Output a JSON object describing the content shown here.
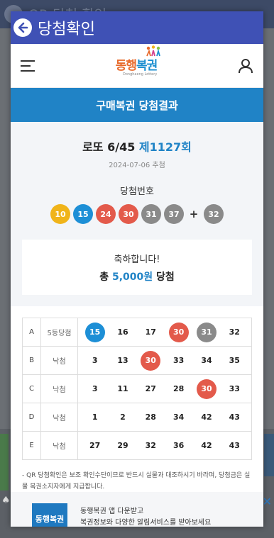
{
  "background": {
    "title": "QR 당첨 확인"
  },
  "dialog": {
    "title": "당첨확인"
  },
  "brand": {
    "name_a": "동행",
    "name_b": "복권",
    "sub": "Donghaeng Lottery"
  },
  "banner": {
    "title": "구매복권 당첨결과"
  },
  "result": {
    "game": "로또 6/45",
    "round": "제1127회",
    "date": "2024-07-06 추첨",
    "win_label": "당첨번호",
    "winning_numbers": [
      {
        "n": "10",
        "color": "#f0b41a"
      },
      {
        "n": "15",
        "color": "#1d8fd6"
      },
      {
        "n": "24",
        "color": "#e35a4b"
      },
      {
        "n": "30",
        "color": "#e35a4b"
      },
      {
        "n": "31",
        "color": "#8a8a8a"
      },
      {
        "n": "37",
        "color": "#8a8a8a"
      }
    ],
    "plus": "+",
    "bonus": {
      "n": "32",
      "color": "#8a8a8a"
    }
  },
  "congrats": {
    "line1": "축하합니다!",
    "prefix": "총 ",
    "amount": "5,000원",
    "suffix": " 당첨"
  },
  "tickets": [
    {
      "label": "A",
      "status": "5등당첨",
      "numbers": [
        {
          "n": "15",
          "color": "#1d8fd6"
        },
        {
          "n": "16",
          "color": ""
        },
        {
          "n": "17",
          "color": ""
        },
        {
          "n": "30",
          "color": "#e35a4b"
        },
        {
          "n": "31",
          "color": "#8a8a8a"
        },
        {
          "n": "32",
          "color": ""
        }
      ]
    },
    {
      "label": "B",
      "status": "낙첨",
      "numbers": [
        {
          "n": "3",
          "color": ""
        },
        {
          "n": "13",
          "color": ""
        },
        {
          "n": "30",
          "color": "#e35a4b"
        },
        {
          "n": "33",
          "color": ""
        },
        {
          "n": "34",
          "color": ""
        },
        {
          "n": "35",
          "color": ""
        }
      ]
    },
    {
      "label": "C",
      "status": "낙첨",
      "numbers": [
        {
          "n": "3",
          "color": ""
        },
        {
          "n": "11",
          "color": ""
        },
        {
          "n": "27",
          "color": ""
        },
        {
          "n": "28",
          "color": ""
        },
        {
          "n": "30",
          "color": "#e35a4b"
        },
        {
          "n": "33",
          "color": ""
        }
      ]
    },
    {
      "label": "D",
      "status": "낙첨",
      "numbers": [
        {
          "n": "1",
          "color": ""
        },
        {
          "n": "2",
          "color": ""
        },
        {
          "n": "28",
          "color": ""
        },
        {
          "n": "34",
          "color": ""
        },
        {
          "n": "42",
          "color": ""
        },
        {
          "n": "43",
          "color": ""
        }
      ]
    },
    {
      "label": "E",
      "status": "낙첨",
      "numbers": [
        {
          "n": "27",
          "color": ""
        },
        {
          "n": "29",
          "color": ""
        },
        {
          "n": "32",
          "color": ""
        },
        {
          "n": "36",
          "color": ""
        },
        {
          "n": "42",
          "color": ""
        },
        {
          "n": "43",
          "color": ""
        }
      ]
    }
  ],
  "notice": "- QR 당첨확인은 보조 확인수단이므로 반드시 실물과 대조하시기 바라며, 당첨금은 실물 복권소지자에게 지급합니다.",
  "promo": {
    "logo": "동행복권",
    "line1": "동행복권 앱 다운받고",
    "line2": "복권정보와 다양한 알림서비스를 받아보세요"
  },
  "icons": {
    "back": "arrow-left-icon",
    "menu": "hamburger-menu-icon",
    "user": "user-icon",
    "close": "close-icon"
  },
  "colors": {
    "header": "#3f51b5",
    "banner": "#2083c6",
    "accent": "#2083c6"
  }
}
